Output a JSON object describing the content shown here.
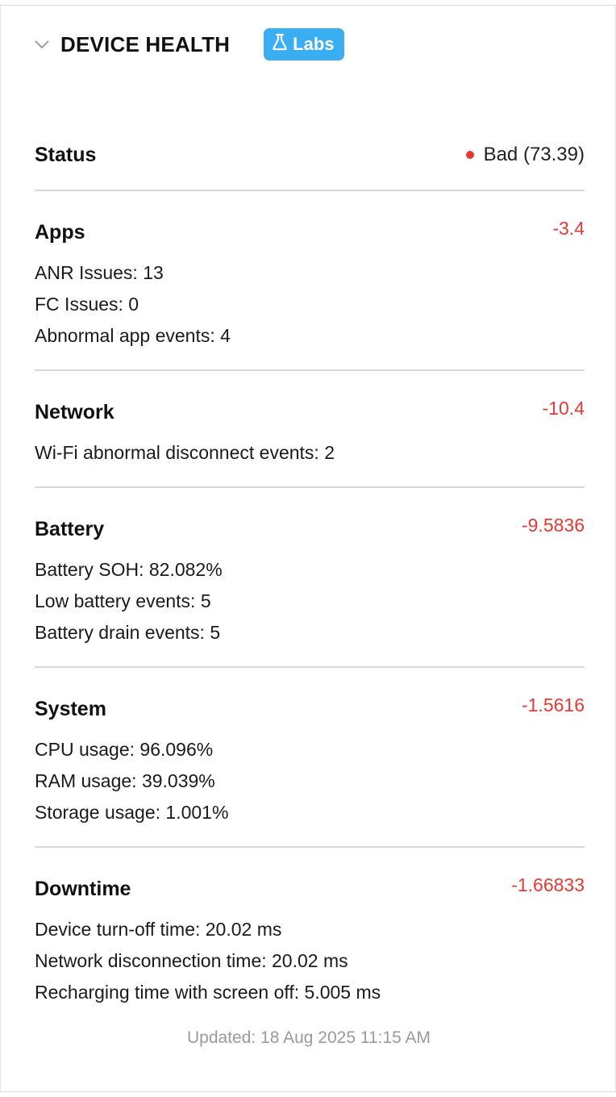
{
  "header": {
    "title": "DEVICE HEALTH",
    "badge_label": "Labs",
    "chevron_icon": "chevron-down-icon",
    "badge_icon": "flask-icon",
    "badge_color": "#3aaef2"
  },
  "status": {
    "label": "Status",
    "value": "Bad (73.39)",
    "indicator_color": "#e53935"
  },
  "sections": [
    {
      "title": "Apps",
      "score": "-3.4",
      "details": [
        "ANR Issues: 13",
        "FC Issues: 0",
        "Abnormal app events: 4"
      ]
    },
    {
      "title": "Network",
      "score": "-10.4",
      "details": [
        "Wi-Fi abnormal disconnect events: 2"
      ]
    },
    {
      "title": "Battery",
      "score": "-9.5836",
      "details": [
        "Battery SOH: 82.082%",
        "Low battery events: 5",
        "Battery drain events: 5"
      ]
    },
    {
      "title": "System",
      "score": "-1.5616",
      "details": [
        "CPU usage: 96.096%",
        "RAM usage: 39.039%",
        "Storage usage: 1.001%"
      ]
    },
    {
      "title": "Downtime",
      "score": "-1.66833",
      "details": [
        "Device turn-off time: 20.02 ms",
        "Network disconnection time: 20.02 ms",
        "Recharging time with screen off: 5.005 ms"
      ]
    }
  ],
  "footer": {
    "updated_text": "Updated: 18 Aug 2025 11:15 AM"
  },
  "colors": {
    "negative_score": "#e53935",
    "divider": "#d8d8d8",
    "muted_text": "#9a9a9a"
  }
}
